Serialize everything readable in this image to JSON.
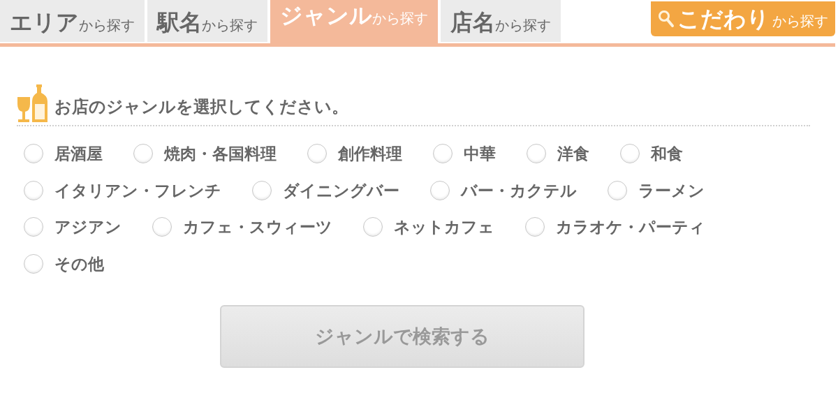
{
  "tabs": [
    {
      "main": "エリア",
      "suffix": "から探す",
      "selected": false
    },
    {
      "main": "駅名",
      "suffix": "から探す",
      "selected": false
    },
    {
      "main": "ジャンル",
      "suffix": "から探す",
      "selected": true
    },
    {
      "main": "店名",
      "suffix": "から探す",
      "selected": false
    }
  ],
  "special_button": {
    "main": "こだわり",
    "suffix": "から探す"
  },
  "heading": "お店のジャンルを選択してください。",
  "genre_rows": [
    [
      {
        "label": "居酒屋",
        "selected": false
      },
      {
        "label": "焼肉・各国料理",
        "selected": false
      },
      {
        "label": "創作料理",
        "selected": false
      },
      {
        "label": "中華",
        "selected": false
      },
      {
        "label": "洋食",
        "selected": false
      },
      {
        "label": "和食",
        "selected": false
      }
    ],
    [
      {
        "label": "イタリアン・フレンチ",
        "selected": false
      },
      {
        "label": "ダイニングバー",
        "selected": false
      },
      {
        "label": "バー・カクテル",
        "selected": false
      },
      {
        "label": "ラーメン",
        "selected": false
      }
    ],
    [
      {
        "label": "アジアン",
        "selected": false
      },
      {
        "label": "カフェ・スウィーツ",
        "selected": false
      },
      {
        "label": "ネットカフェ",
        "selected": false
      },
      {
        "label": "カラオケ・パーティ",
        "selected": false
      }
    ],
    [
      {
        "label": "その他",
        "selected": false
      }
    ]
  ],
  "search_button": {
    "label": "ジャンルで検索する",
    "disabled": true
  }
}
